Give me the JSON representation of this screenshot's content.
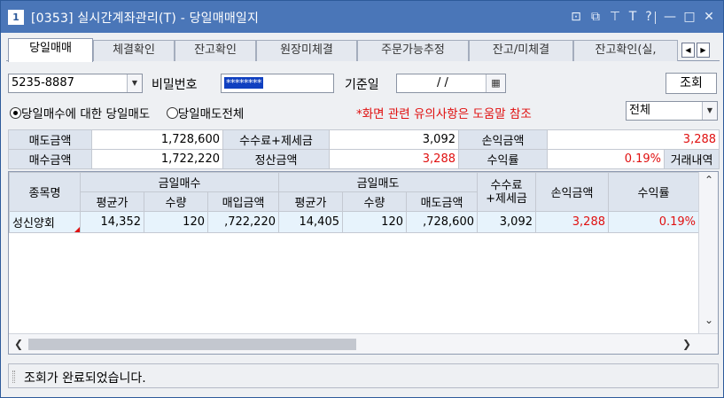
{
  "window": {
    "number": "1",
    "title": "[0353]  실시간계좌관리(T) - 당일매매일지",
    "icons": [
      "restore-icon",
      "copy-icon",
      "pin-icon",
      "font-icon",
      "help-icon",
      "minimize-icon",
      "maximize-icon",
      "close-icon"
    ],
    "icon_glyphs": {
      "restore": "⊡",
      "copy": "⧉",
      "pin": "⊤",
      "font": "T",
      "help": "?",
      "minimize": "—",
      "maximize": "□",
      "close": "✕"
    }
  },
  "tabs": [
    {
      "label": "당일매매",
      "active": true
    },
    {
      "label": "체결확인",
      "active": false
    },
    {
      "label": "잔고확인",
      "active": false
    },
    {
      "label": "원장미체결",
      "active": false
    },
    {
      "label": "주문가능추정",
      "active": false
    },
    {
      "label": "잔고/미체결",
      "active": false
    },
    {
      "label": "잔고확인(실,",
      "active": false
    }
  ],
  "account": {
    "number": "5235-8887",
    "password_label": "비밀번호",
    "password_value": "********",
    "date_label": "기준일",
    "date_value": "/   /",
    "search_button": "조회"
  },
  "options": {
    "radio_1": "당일매수에 대한 당일매도",
    "radio_2": "당일매도전체",
    "warning": "*화면 관련 유의사항은 도움말 참조",
    "filter_value": "전체"
  },
  "summary": {
    "sell_amount_label": "매도금액",
    "sell_amount": "1,728,600",
    "fee_tax_label": "수수료+제세금",
    "fee_tax": "3,092",
    "pnl_label": "손익금액",
    "pnl": "3,288",
    "buy_amount_label": "매수금액",
    "buy_amount": "1,722,220",
    "settle_label": "정산금액",
    "settle": "3,288",
    "return_label": "수익률",
    "return_rate": "0.19%",
    "history_label": "거래내역"
  },
  "grid": {
    "headers": {
      "name": "종목명",
      "buy_group": "금일매수",
      "sell_group": "금일매도",
      "fee": "수수료\n+제세금",
      "pnl": "손익금액",
      "return": "수익률",
      "avg_price": "평균가",
      "qty": "수량",
      "buy_amount": "매입금액",
      "sell_amount": "매도금액"
    },
    "rows": [
      {
        "name": "성신양회",
        "buy_avg": "14,352",
        "buy_qty": "120",
        "buy_amount": ",722,220",
        "sell_avg": "14,405",
        "sell_qty": "120",
        "sell_amount": ",728,600",
        "fee": "3,092",
        "pnl": "3,288",
        "return": "0.19%"
      }
    ]
  },
  "status": {
    "message": "조회가 완료되었습니다."
  },
  "colors": {
    "title_bar": "#4a76b8",
    "label_bg": "#dde4ee",
    "row_bg": "#e7f3fc",
    "profit_red": "#e01010"
  }
}
